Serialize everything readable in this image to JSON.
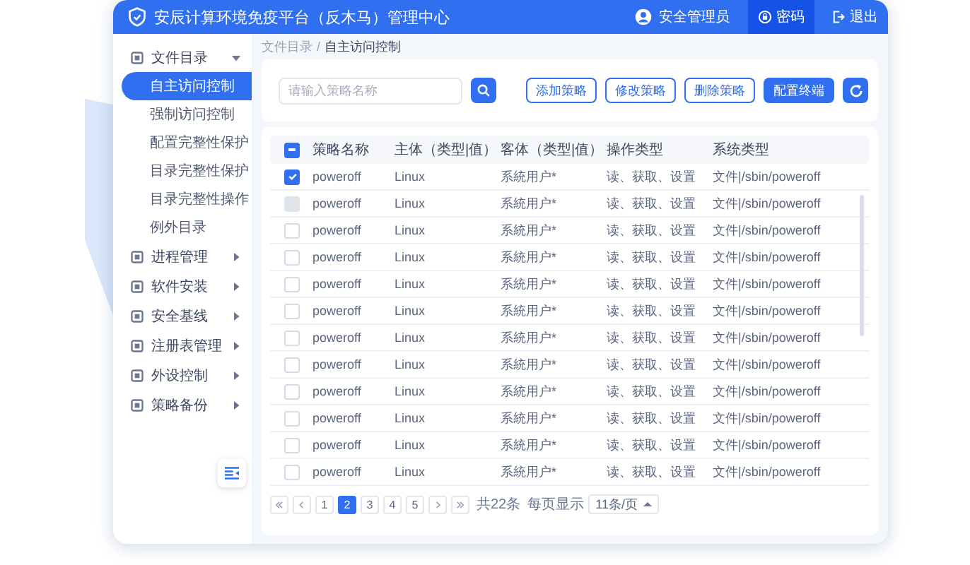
{
  "header": {
    "title": "安辰计算环境免疫平台（反木马）管理中心",
    "user": "安全管理员",
    "actions": [
      {
        "label": "密码",
        "selected": true
      },
      {
        "label": "退出",
        "selected": false
      }
    ]
  },
  "sidebar": {
    "items": [
      {
        "label": "文件目录",
        "expanded": true,
        "children": [
          {
            "label": "自主访问控制",
            "selected": true
          },
          {
            "label": "强制访问控制",
            "selected": false
          },
          {
            "label": "配置完整性保护",
            "selected": false
          },
          {
            "label": "目录完整性保护",
            "selected": false
          },
          {
            "label": "目录完整性操作",
            "selected": false
          },
          {
            "label": "例外目录",
            "selected": false
          }
        ]
      },
      {
        "label": "进程管理",
        "expanded": false
      },
      {
        "label": "软件安装",
        "expanded": false
      },
      {
        "label": "安全基线",
        "expanded": false
      },
      {
        "label": "注册表管理",
        "expanded": false
      },
      {
        "label": "外设控制",
        "expanded": false
      },
      {
        "label": "策略备份",
        "expanded": false
      }
    ]
  },
  "breadcrumb": {
    "items": [
      "文件目录",
      "自主访问控制"
    ],
    "separator": "/"
  },
  "search": {
    "placeholder": "请输入策略名称"
  },
  "buttons": [
    {
      "label": "添加策略",
      "kind": "outline"
    },
    {
      "label": "修改策略",
      "kind": "outline"
    },
    {
      "label": "删除策略",
      "kind": "outline"
    },
    {
      "label": "配置终端",
      "kind": "primary"
    }
  ],
  "table": {
    "select_all_partial": true,
    "columns": [
      "策略名称",
      "主体（类型|值）",
      "客体（类型|值）",
      "操作类型",
      "系统类型"
    ],
    "rows": [
      {
        "checked": true,
        "disabled": false,
        "cells": [
          "poweroff",
          "Linux",
          "系統用户*",
          "读、获取、设置",
          "文件|/sbin/poweroff"
        ]
      },
      {
        "checked": false,
        "disabled": true,
        "cells": [
          "poweroff",
          "Linux",
          "系統用户*",
          "读、获取、设置",
          "文件|/sbin/poweroff"
        ]
      },
      {
        "checked": false,
        "disabled": false,
        "cells": [
          "poweroff",
          "Linux",
          "系統用户*",
          "读、获取、设置",
          "文件|/sbin/poweroff"
        ]
      },
      {
        "checked": false,
        "disabled": false,
        "cells": [
          "poweroff",
          "Linux",
          "系統用户*",
          "读、获取、设置",
          "文件|/sbin/poweroff"
        ]
      },
      {
        "checked": false,
        "disabled": false,
        "cells": [
          "poweroff",
          "Linux",
          "系統用户*",
          "读、获取、设置",
          "文件|/sbin/poweroff"
        ]
      },
      {
        "checked": false,
        "disabled": false,
        "cells": [
          "poweroff",
          "Linux",
          "系統用户*",
          "读、获取、设置",
          "文件|/sbin/poweroff"
        ]
      },
      {
        "checked": false,
        "disabled": false,
        "cells": [
          "poweroff",
          "Linux",
          "系統用户*",
          "读、获取、设置",
          "文件|/sbin/poweroff"
        ]
      },
      {
        "checked": false,
        "disabled": false,
        "cells": [
          "poweroff",
          "Linux",
          "系統用户*",
          "读、获取、设置",
          "文件|/sbin/poweroff"
        ]
      },
      {
        "checked": false,
        "disabled": false,
        "cells": [
          "poweroff",
          "Linux",
          "系統用户*",
          "读、获取、设置",
          "文件|/sbin/poweroff"
        ]
      },
      {
        "checked": false,
        "disabled": false,
        "cells": [
          "poweroff",
          "Linux",
          "系統用户*",
          "读、获取、设置",
          "文件|/sbin/poweroff"
        ]
      },
      {
        "checked": false,
        "disabled": false,
        "cells": [
          "poweroff",
          "Linux",
          "系統用户*",
          "读、获取、设置",
          "文件|/sbin/poweroff"
        ]
      },
      {
        "checked": false,
        "disabled": false,
        "cells": [
          "poweroff",
          "Linux",
          "系統用户*",
          "读、获取、设置",
          "文件|/sbin/poweroff"
        ]
      }
    ]
  },
  "pagination": {
    "pages": [
      {
        "label": "1",
        "selected": false
      },
      {
        "label": "2",
        "selected": true
      },
      {
        "label": "3",
        "selected": false
      },
      {
        "label": "4",
        "selected": false
      },
      {
        "label": "5",
        "selected": false
      }
    ],
    "total": "共22条",
    "per_page_label": "每页显示",
    "page_size": "11条/页"
  }
}
